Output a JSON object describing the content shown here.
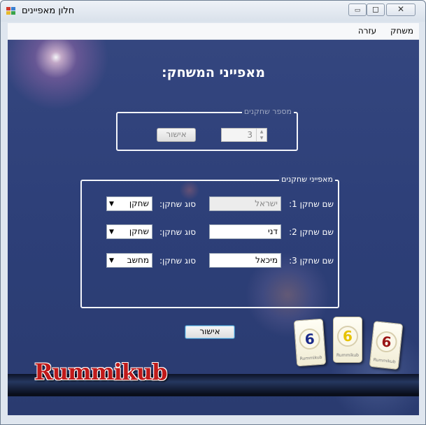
{
  "window": {
    "title": "חלון מאפיינים",
    "minimize": "▭",
    "maximize": "◻",
    "close": "✕"
  },
  "menu": {
    "items": [
      {
        "label": "משחק"
      },
      {
        "label": "עזרה"
      }
    ]
  },
  "main": {
    "heading": "מאפייני המשחק:",
    "players_count_group": {
      "legend": "מספר שחקנים",
      "spinner_value": "3",
      "confirm_label": "אישור"
    },
    "players_group": {
      "legend": "מאפייני שחקנים",
      "type_label": "סוג שחקן:",
      "rows": [
        {
          "name_label": "שם שחקן 1:",
          "name_value": "ישראל",
          "type_value": "שחקן"
        },
        {
          "name_label": "שם שחקן 2:",
          "name_value": "דני",
          "type_value": "שחקן"
        },
        {
          "name_label": "שם שחקן 3:",
          "name_value": "מיכאל",
          "type_value": "מחשב"
        }
      ]
    },
    "confirm_button": "אישור",
    "logo_text": "Rummikub",
    "tiles": [
      {
        "number": "6",
        "color": "#1b2a8a",
        "brand": "Rummikub"
      },
      {
        "number": "6",
        "color": "#e6c200",
        "brand": "Rummikub"
      },
      {
        "number": "6",
        "color": "#9a1515",
        "brand": "Rummikub"
      }
    ]
  },
  "colors": {
    "background": "#2f417a",
    "legend_disabled": "#9ea7c2",
    "legend_enabled": "#ffffff"
  }
}
